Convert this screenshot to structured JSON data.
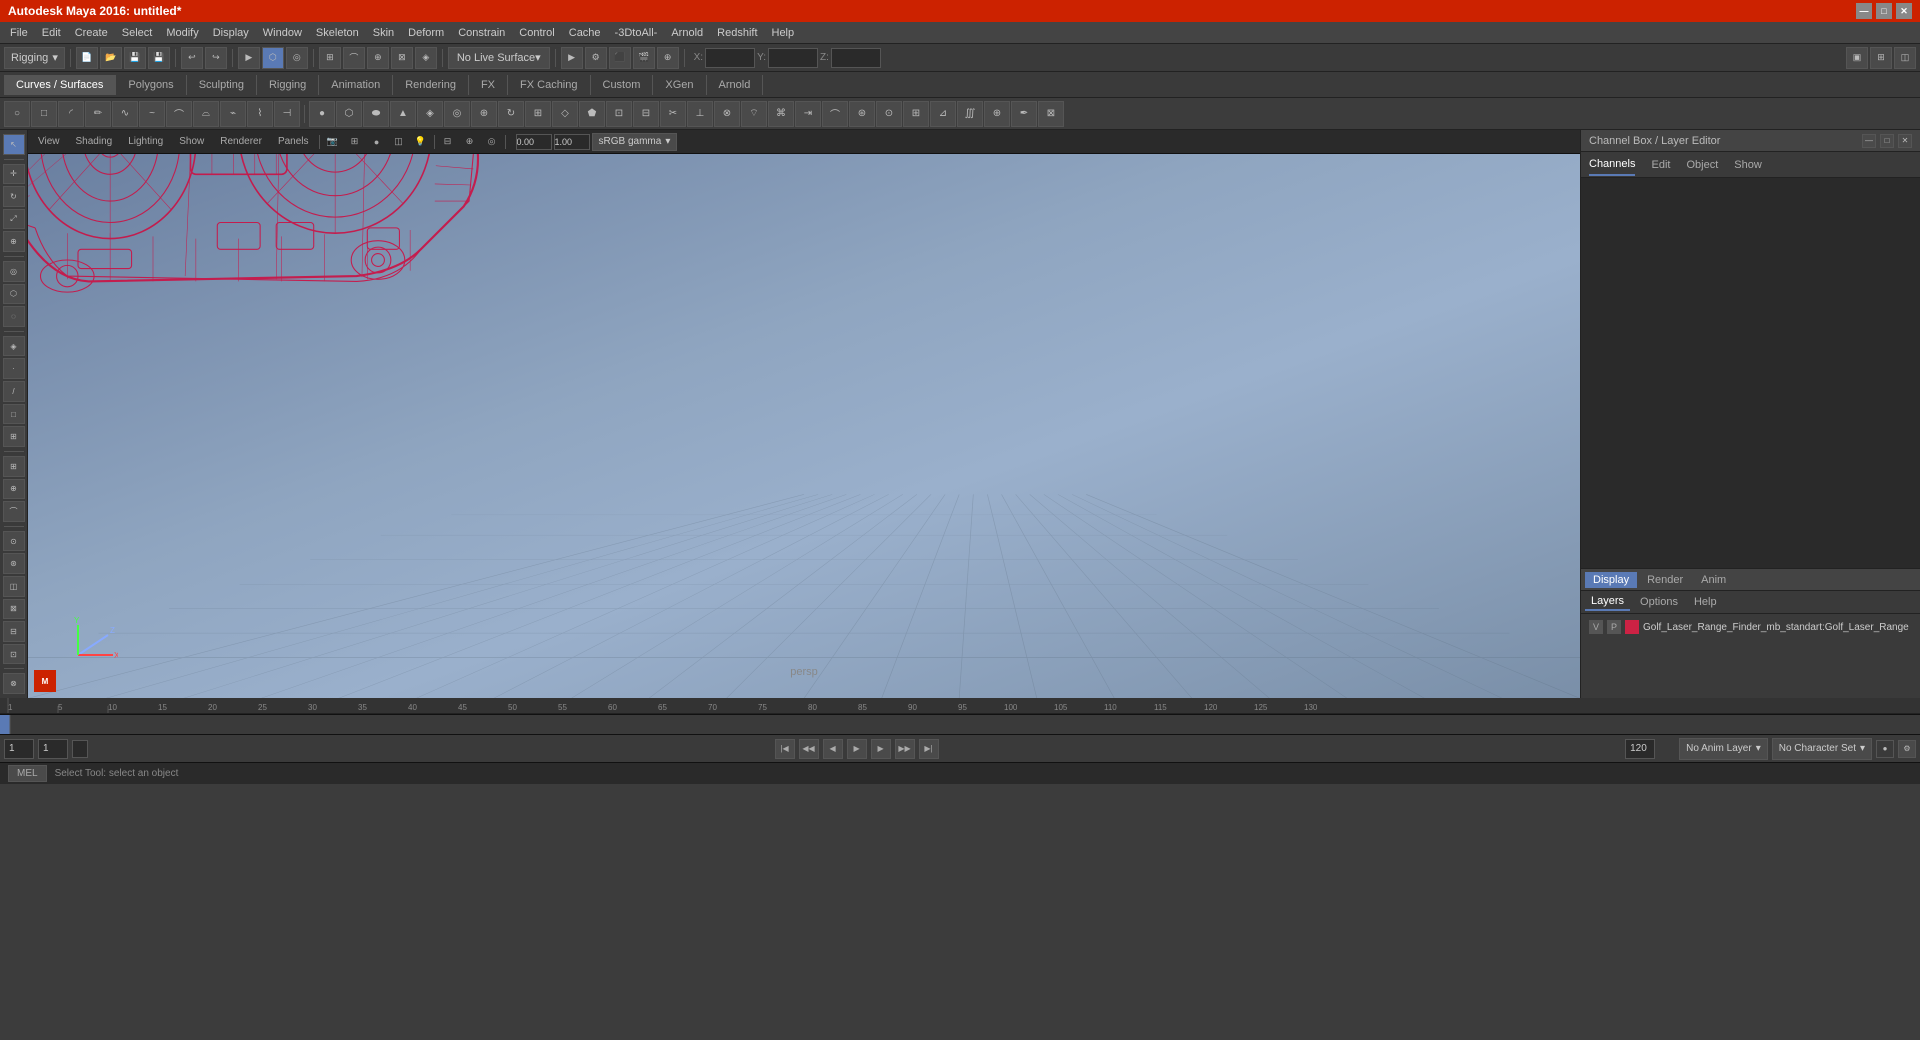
{
  "titlebar": {
    "title": "Autodesk Maya 2016: untitled*",
    "minimize": "—",
    "maximize": "□",
    "close": "✕"
  },
  "menubar": {
    "items": [
      "File",
      "Edit",
      "Create",
      "Select",
      "Modify",
      "Display",
      "Window",
      "Skeleton",
      "Skin",
      "Deform",
      "Constrain",
      "Control",
      "Cache",
      "-3DtoAll-",
      "Arnold",
      "Redshift",
      "Help"
    ]
  },
  "toolbar1": {
    "rigging_label": "Rigging",
    "no_live_surface": "No Live Surface"
  },
  "tabs": {
    "items": [
      "Curves / Surfaces",
      "Polygons",
      "Sculpting",
      "Rigging",
      "Animation",
      "Rendering",
      "FX",
      "FX Caching",
      "Custom",
      "XGen",
      "Arnold"
    ]
  },
  "viewport": {
    "view_label": "View",
    "shading_label": "Shading",
    "lighting_label": "Lighting",
    "show_label": "Show",
    "renderer_label": "Renderer",
    "panels_label": "Panels",
    "perspective_label": "persp",
    "gamma_label": "sRGB gamma",
    "gamma_value": "0.00",
    "gain_value": "1.00"
  },
  "right_panel": {
    "title": "Channel Box / Layer Editor",
    "tabs": [
      "Channels",
      "Edit",
      "Object",
      "Show"
    ],
    "bottom_tabs": [
      "Display",
      "Render",
      "Anim"
    ],
    "layer_tabs": [
      "Layers",
      "Options",
      "Help"
    ],
    "layer": {
      "v": "V",
      "p": "P",
      "name": "Golf_Laser_Range_Finder_mb_standart:Golf_Laser_Range"
    }
  },
  "timeline": {
    "start": "1",
    "end": "120",
    "current": "1",
    "ticks": [
      "1",
      "5",
      "10",
      "15",
      "20",
      "25",
      "30",
      "35",
      "40",
      "45",
      "50",
      "55",
      "60",
      "65",
      "70",
      "75",
      "80",
      "85",
      "90",
      "95",
      "100",
      "105",
      "110",
      "115",
      "120",
      "125",
      "130"
    ]
  },
  "bottom_toolbar": {
    "frame_start": "1",
    "frame_current": "1",
    "frame_end": "120",
    "anim_layer": "No Anim Layer",
    "character_set": "No Character Set"
  },
  "status_bar": {
    "mel_label": "MEL",
    "status_text": "Select Tool: select an object"
  },
  "vertical_side_label": "Channel Box / Layer Editor"
}
